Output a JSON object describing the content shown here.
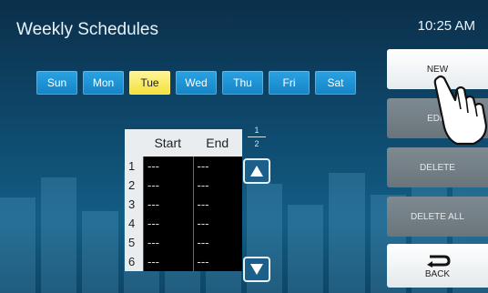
{
  "header": {
    "title": "Weekly Schedules",
    "clock": "10:25 AM"
  },
  "days": [
    {
      "label": "Sun",
      "selected": false
    },
    {
      "label": "Mon",
      "selected": false
    },
    {
      "label": "Tue",
      "selected": true
    },
    {
      "label": "Wed",
      "selected": false
    },
    {
      "label": "Thu",
      "selected": false
    },
    {
      "label": "Fri",
      "selected": false
    },
    {
      "label": "Sat",
      "selected": false
    }
  ],
  "table": {
    "headers": {
      "start": "Start",
      "end": "End"
    },
    "rows": [
      {
        "num": "1",
        "start": "---",
        "end": "---"
      },
      {
        "num": "2",
        "start": "---",
        "end": "---"
      },
      {
        "num": "3",
        "start": "---",
        "end": "---"
      },
      {
        "num": "4",
        "start": "---",
        "end": "---"
      },
      {
        "num": "5",
        "start": "---",
        "end": "---"
      },
      {
        "num": "6",
        "start": "---",
        "end": "---"
      }
    ]
  },
  "pagination": {
    "current": "1",
    "total": "2"
  },
  "side_buttons": {
    "new": "NEW",
    "edit": "EDIT",
    "delete": "DELETE",
    "delete_all": "DELETE ALL",
    "back": "BACK"
  },
  "icons": {
    "up": "arrow-up-icon",
    "down": "arrow-down-icon",
    "back": "back-arrow-icon",
    "pointer": "pointing-hand-icon"
  }
}
